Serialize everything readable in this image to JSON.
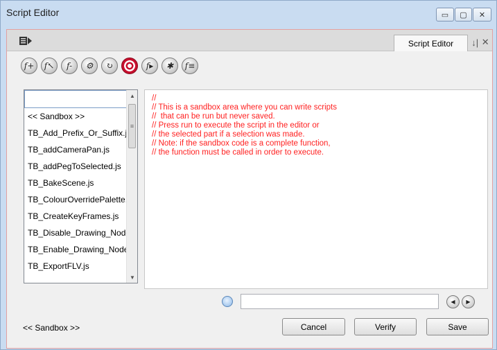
{
  "window": {
    "title": "Script Editor",
    "controls": {
      "minimize": "▭",
      "maximize": "▢",
      "close": "✕"
    }
  },
  "panel": {
    "tab_label": "Script Editor",
    "tab_tools": {
      "dock": "↓|",
      "close": "✕"
    }
  },
  "toolbar": {
    "icons": [
      {
        "name": "new-script-icon",
        "glyph": "f+"
      },
      {
        "name": "import-script-icon",
        "glyph": "f↖"
      },
      {
        "name": "delete-script-icon",
        "glyph": "f-"
      },
      {
        "name": "set-target-icon",
        "glyph": "⚙"
      },
      {
        "name": "reload-icon",
        "glyph": "↻"
      },
      {
        "name": "target-icon",
        "glyph": ""
      },
      {
        "name": "run-script-icon",
        "glyph": "f▸"
      },
      {
        "name": "debug-icon",
        "glyph": "✱"
      },
      {
        "name": "function-list-icon",
        "glyph": "f≡"
      }
    ]
  },
  "script_list": {
    "items": [
      "",
      "<< Sandbox >>",
      "TB_Add_Prefix_Or_Suffix.js",
      "TB_addCameraPan.js",
      "TB_addPegToSelected.js",
      "TB_BakeScene.js",
      "TB_ColourOverridePalette.js",
      "TB_CreateKeyFrames.js",
      "TB_Disable_Drawing_Nodes.js",
      "TB_Enable_Drawing_Nodes.js",
      "TB_ExportFLV.js"
    ]
  },
  "editor": {
    "code": "//\n// This is a sandbox area where you can write scripts\n//  that can be run but never saved.\n// Press run to execute the script in the editor or\n// the selected part if a selection was made.\n// Note: if the sandbox code is a complete function,\n// the function must be called in order to execute."
  },
  "search": {
    "value": "",
    "placeholder": ""
  },
  "footer": {
    "status": "<< Sandbox >>",
    "cancel_label": "Cancel",
    "verify_label": "Verify",
    "save_label": "Save"
  },
  "colors": {
    "code_text": "#ff1f1f",
    "client_border": "#e3a0a0",
    "title_bg": "#c9dcf1"
  }
}
